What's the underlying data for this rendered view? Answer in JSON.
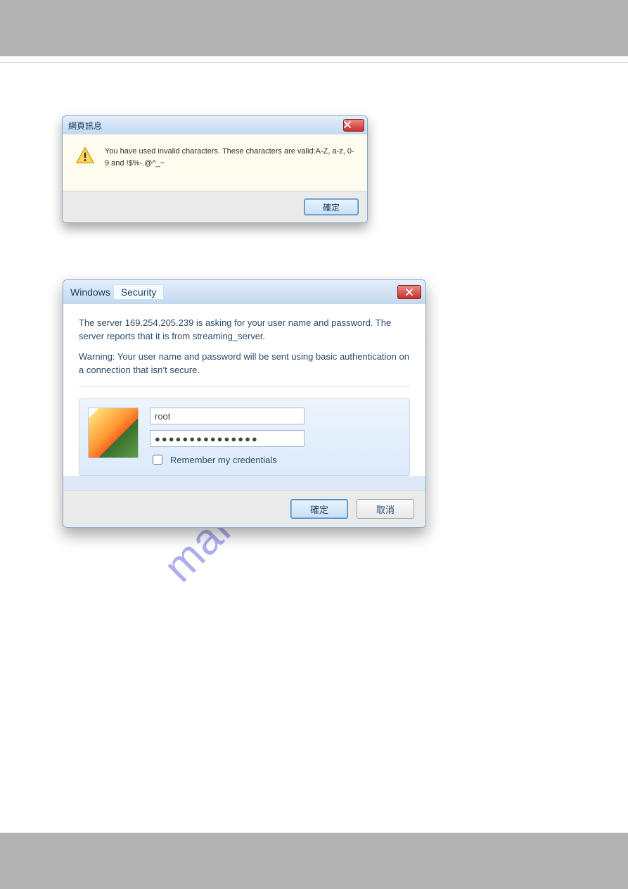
{
  "watermark": "manualshive.com",
  "dialog1": {
    "title": "網頁訊息",
    "message": "You have used invalid characters. These characters are valid:A-Z, a-z, 0-9 and !$%-.@^_~",
    "ok": "確定"
  },
  "dialog2": {
    "title_windows": "Windows",
    "title_security": "Security",
    "para1": "The server 169.254.205.239 is asking for your user name and password. The server reports that it is from streaming_server.",
    "para2": "Warning: Your user name and password will be sent using basic authentication on a connection that isn’t secure.",
    "username_value": "root",
    "password_value": "●●●●●●●●●●●●●●●",
    "remember": "Remember my credentials",
    "ok": "確定",
    "cancel": "取消"
  }
}
